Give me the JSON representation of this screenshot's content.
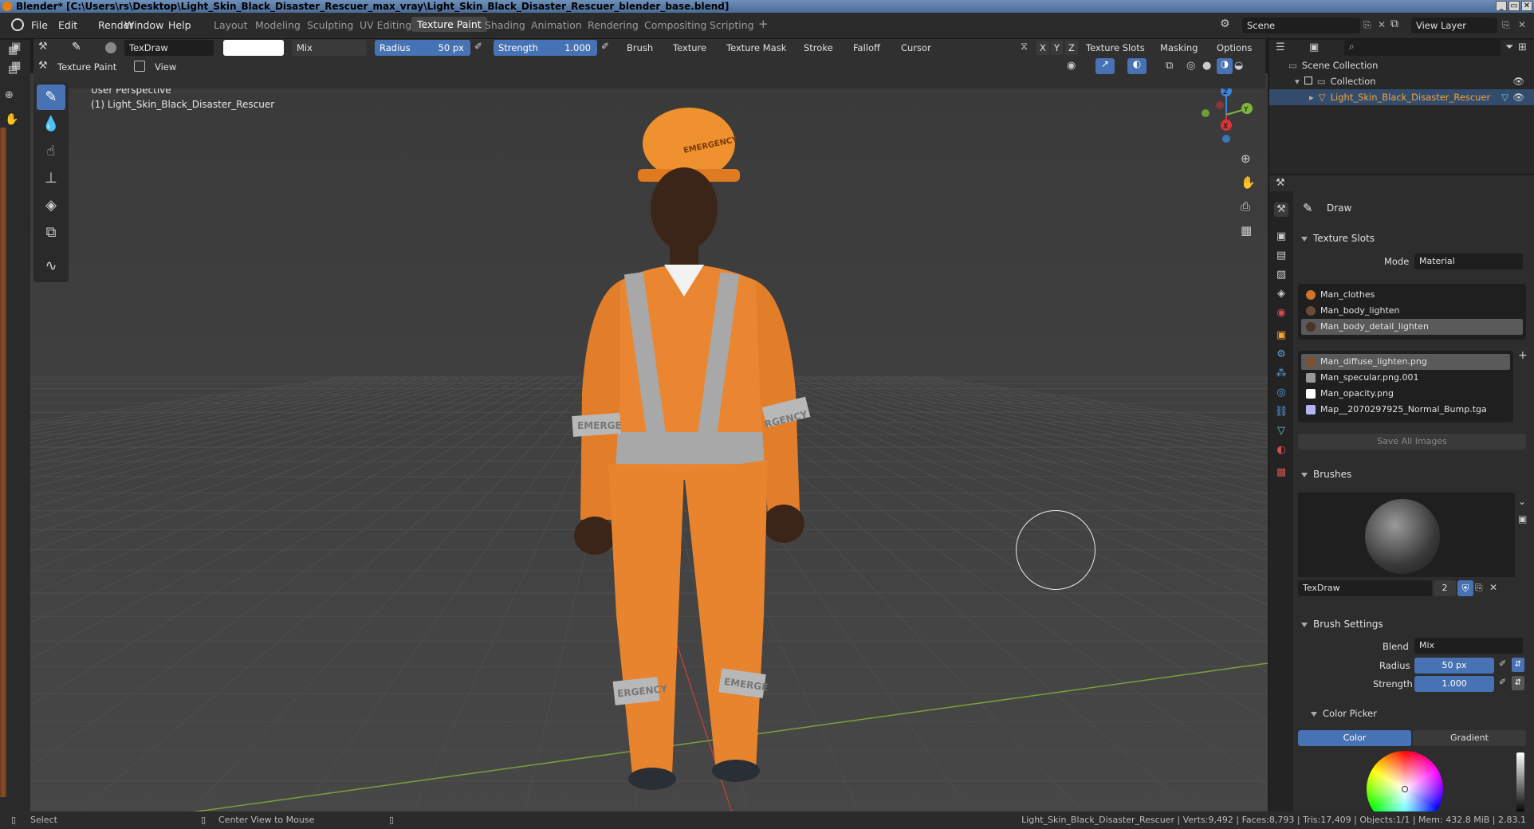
{
  "window": {
    "title": "Blender* [C:\\Users\\rs\\Desktop\\Light_Skin_Black_Disaster_Rescuer_max_vray\\Light_Skin_Black_Disaster_Rescuer_blender_base.blend]"
  },
  "menu": {
    "file": "File",
    "edit": "Edit",
    "render": "Render",
    "window": "Window",
    "help": "Help"
  },
  "workspaces": {
    "layout": "Layout",
    "modeling": "Modeling",
    "sculpting": "Sculpting",
    "uv_editing": "UV Editing",
    "texture_paint": "Texture Paint",
    "shading": "Shading",
    "animation": "Animation",
    "rendering": "Rendering",
    "compositing": "Compositing",
    "scripting": "Scripting",
    "add": "+"
  },
  "scene": {
    "scene_name": "Scene",
    "view_layer": "View Layer"
  },
  "tool_header": {
    "brush_name": "TexDraw",
    "blend": "Mix",
    "radius_label": "Radius",
    "radius_value": "50 px",
    "strength_label": "Strength",
    "strength_value": "1.000",
    "brush": "Brush",
    "texture": "Texture",
    "texture_mask": "Texture Mask",
    "stroke": "Stroke",
    "falloff": "Falloff",
    "cursor": "Cursor",
    "x": "X",
    "y": "Y",
    "z": "Z",
    "texture_slots": "Texture Slots",
    "masking": "Masking",
    "options": "Options"
  },
  "viewport_header": {
    "mode": "Texture Paint",
    "view": "View"
  },
  "viewport": {
    "perspective": "User Perspective",
    "object_label": "(1) Light_Skin_Black_Disaster_Rescuer",
    "gizmo_x": "X",
    "gizmo_y": "Y",
    "gizmo_z": "Z",
    "reflective_text": "EMERGENCY",
    "sleeve_left": "EMERGE",
    "sleeve_right": "RGENCY",
    "leg_left": "ERGENCY",
    "leg_right": "EMERGE"
  },
  "outliner": {
    "root": "Scene Collection",
    "collection": "Collection",
    "object": "Light_Skin_Black_Disaster_Rescuer"
  },
  "properties": {
    "tool_name": "Draw",
    "texture_slots": {
      "title": "Texture Slots",
      "mode_label": "Mode",
      "mode_value": "Material",
      "materials": [
        "Man_clothes",
        "Man_body_lighten",
        "Man_body_detail_lighten"
      ],
      "images": [
        "Man_diffuse_lighten.png",
        "Man_specular.png.001",
        "Man_opacity.png",
        "Map__2070297925_Normal_Bump.tga"
      ],
      "save_all": "Save All Images"
    },
    "brushes": {
      "title": "Brushes",
      "name": "TexDraw",
      "users": "2"
    },
    "brush_settings": {
      "title": "Brush Settings",
      "blend_label": "Blend",
      "blend_value": "Mix",
      "radius_label": "Radius",
      "radius_value": "50 px",
      "strength_label": "Strength",
      "strength_value": "1.000"
    },
    "color_picker": {
      "title": "Color Picker",
      "tab_color": "Color",
      "tab_gradient": "Gradient"
    }
  },
  "status": {
    "select": "Select",
    "center_view": "Center View to Mouse",
    "stats": "Light_Skin_Black_Disaster_Rescuer | Verts:9,492 | Faces:8,793 | Tris:17,409 | Objects:1/1 | Mem: 432.8 MiB | 2.83.1"
  },
  "colors": {
    "accent": "#4772b3",
    "selected_object": "#f0a33a",
    "suit": "#e8832e",
    "gizmo_x": "#d6343a",
    "gizmo_y": "#7db63b",
    "gizmo_z": "#3b84d6"
  }
}
